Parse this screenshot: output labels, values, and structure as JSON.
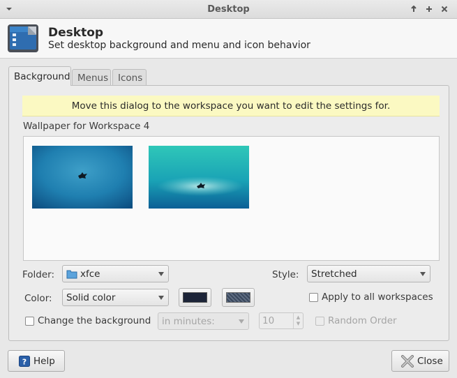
{
  "window": {
    "title": "Desktop",
    "controls": [
      "window-menu-icon",
      "minimize-icon",
      "maximize-icon",
      "close-icon"
    ]
  },
  "header": {
    "title": "Desktop",
    "subtitle": "Set desktop background and menu and icon behavior"
  },
  "tabs": [
    {
      "label": "Background",
      "active": true
    },
    {
      "label": "Menus",
      "active": false
    },
    {
      "label": "Icons",
      "active": false
    }
  ],
  "background": {
    "info_message": "Move this dialog to the workspace you want to edit the settings for.",
    "wallpaper_label": "Wallpaper for Workspace 4",
    "folder_label": "Folder:",
    "folder_value": "xfce",
    "style_label": "Style:",
    "style_value": "Stretched",
    "color_label": "Color:",
    "color_value": "Solid color",
    "primary_color": "#1c2438",
    "apply_all_label": "Apply to all workspaces",
    "change_bg_label": "Change the background",
    "interval_value": "in minutes:",
    "interval_amount": "10",
    "random_order_label": "Random Order"
  },
  "footer": {
    "help_label": "Help",
    "close_label": "Close"
  },
  "colors": {
    "info_bar": "#fbf9c2",
    "accent_blue": "#1f6fb5"
  }
}
